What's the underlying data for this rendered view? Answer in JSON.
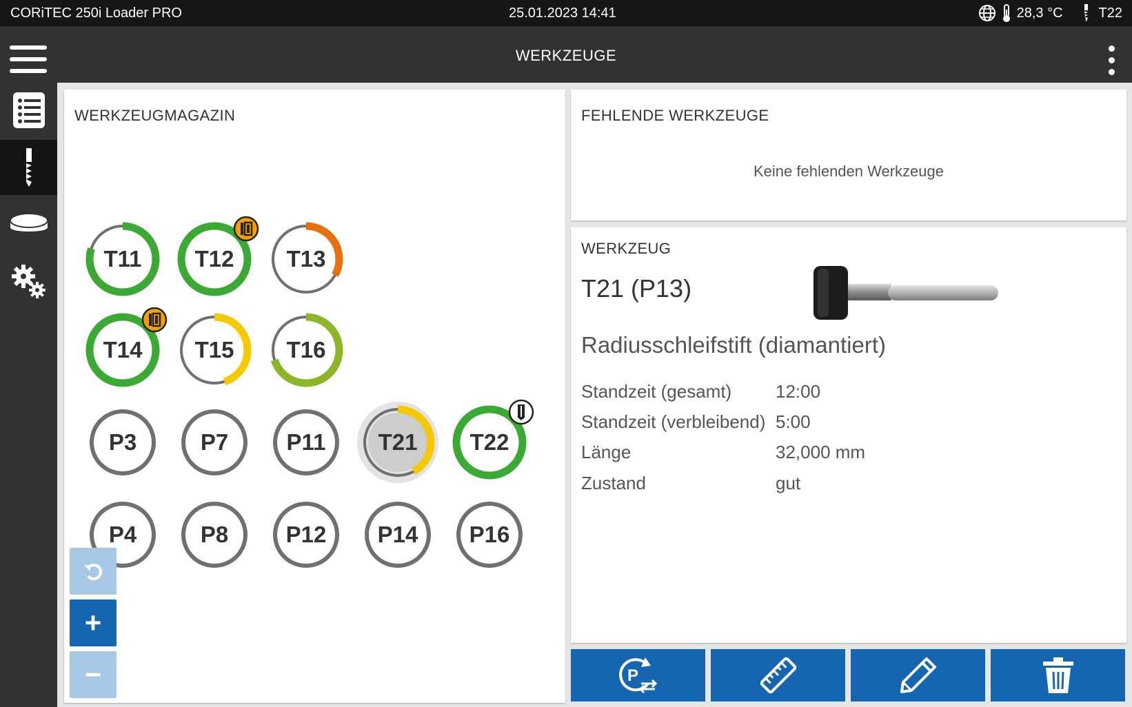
{
  "statusbar": {
    "app_name": "CORiTEC 250i Loader PRO",
    "datetime": "25.01.2023 14:41",
    "temperature": "28,3 °C",
    "active_tool": "T22"
  },
  "header": {
    "title": "WERKZEUGE"
  },
  "sidebar": {
    "items": [
      {
        "name": "jobs",
        "icon": "list-icon",
        "active": false
      },
      {
        "name": "tools",
        "icon": "tool-icon",
        "active": true
      },
      {
        "name": "blanks",
        "icon": "disc-icon",
        "active": false
      },
      {
        "name": "settings",
        "icon": "gears-icon",
        "active": false
      }
    ]
  },
  "magazine": {
    "title": "WERKZEUGMAGAZIN",
    "tools": [
      {
        "label": "T11",
        "fill": 0.8,
        "color": "#3aaa35"
      },
      {
        "label": "T12",
        "fill": 1.0,
        "color": "#3aaa35",
        "badge": "warning"
      },
      {
        "label": "T13",
        "fill": 0.33,
        "color": "#e8700a"
      },
      {
        "label": "T14",
        "fill": 1.0,
        "color": "#3aaa35",
        "badge": "warning"
      },
      {
        "label": "T15",
        "fill": 0.45,
        "color": "#f5c800"
      },
      {
        "label": "T16",
        "fill": 0.7,
        "color": "#8db528"
      },
      {
        "label": "P3",
        "fill": 0
      },
      {
        "label": "P7",
        "fill": 0
      },
      {
        "label": "P11",
        "fill": 0
      },
      {
        "label": "T21",
        "fill": 0.42,
        "color": "#f5c800",
        "selected": true
      },
      {
        "label": "T22",
        "fill": 1.0,
        "color": "#3aaa35",
        "badge": "spindle"
      },
      {
        "label": "P4",
        "fill": 0
      },
      {
        "label": "P8",
        "fill": 0
      },
      {
        "label": "P12",
        "fill": 0
      },
      {
        "label": "P14",
        "fill": 0
      },
      {
        "label": "P16",
        "fill": 0
      }
    ],
    "zoom": {
      "undo_icon": "undo-icon",
      "plus": "+",
      "minus": "−"
    }
  },
  "missing": {
    "title": "FEHLENDE WERKZEUGE",
    "empty_text": "Keine fehlenden Werkzeuge"
  },
  "detail": {
    "title": "WERKZEUG",
    "tool_id": "T21 (P13)",
    "tool_name": "Radiusschleifstift (diamantiert)",
    "rows": [
      {
        "label": "Standzeit (gesamt)",
        "value": "12:00"
      },
      {
        "label": "Standzeit (verbleibend)",
        "value": "5:00"
      },
      {
        "label": "Länge",
        "value": "32,000 mm"
      },
      {
        "label": "Zustand",
        "value": "gut"
      }
    ]
  },
  "actions": [
    {
      "name": "move-position-button",
      "icon": "position-swap-icon"
    },
    {
      "name": "measure-button",
      "icon": "ruler-icon"
    },
    {
      "name": "edit-button",
      "icon": "pencil-icon"
    },
    {
      "name": "delete-button",
      "icon": "trash-icon"
    }
  ],
  "colors": {
    "accent": "#1565b1",
    "ok": "#3aaa35",
    "warn": "#f5c800",
    "alert": "#e8700a"
  }
}
